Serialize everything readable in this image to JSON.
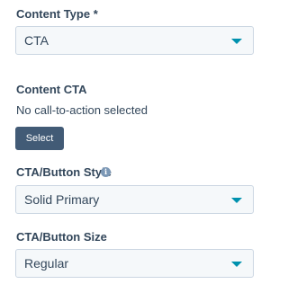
{
  "content_type": {
    "label": "Content Type *",
    "value": "CTA"
  },
  "content_cta": {
    "label": "Content CTA",
    "helper": "No call-to-action selected",
    "select_button": "Select"
  },
  "button_style": {
    "label": "CTA/Button Style",
    "info_icon": "info-icon",
    "value": "Solid Primary"
  },
  "button_size": {
    "label": "CTA/Button Size",
    "value": "Regular"
  },
  "colors": {
    "text": "#33475b",
    "field_bg": "#f5f8fa",
    "field_border": "#cbd6e2",
    "caret": "#0091ae",
    "button_bg": "#425b76",
    "info_icon": "#7c98b6"
  }
}
